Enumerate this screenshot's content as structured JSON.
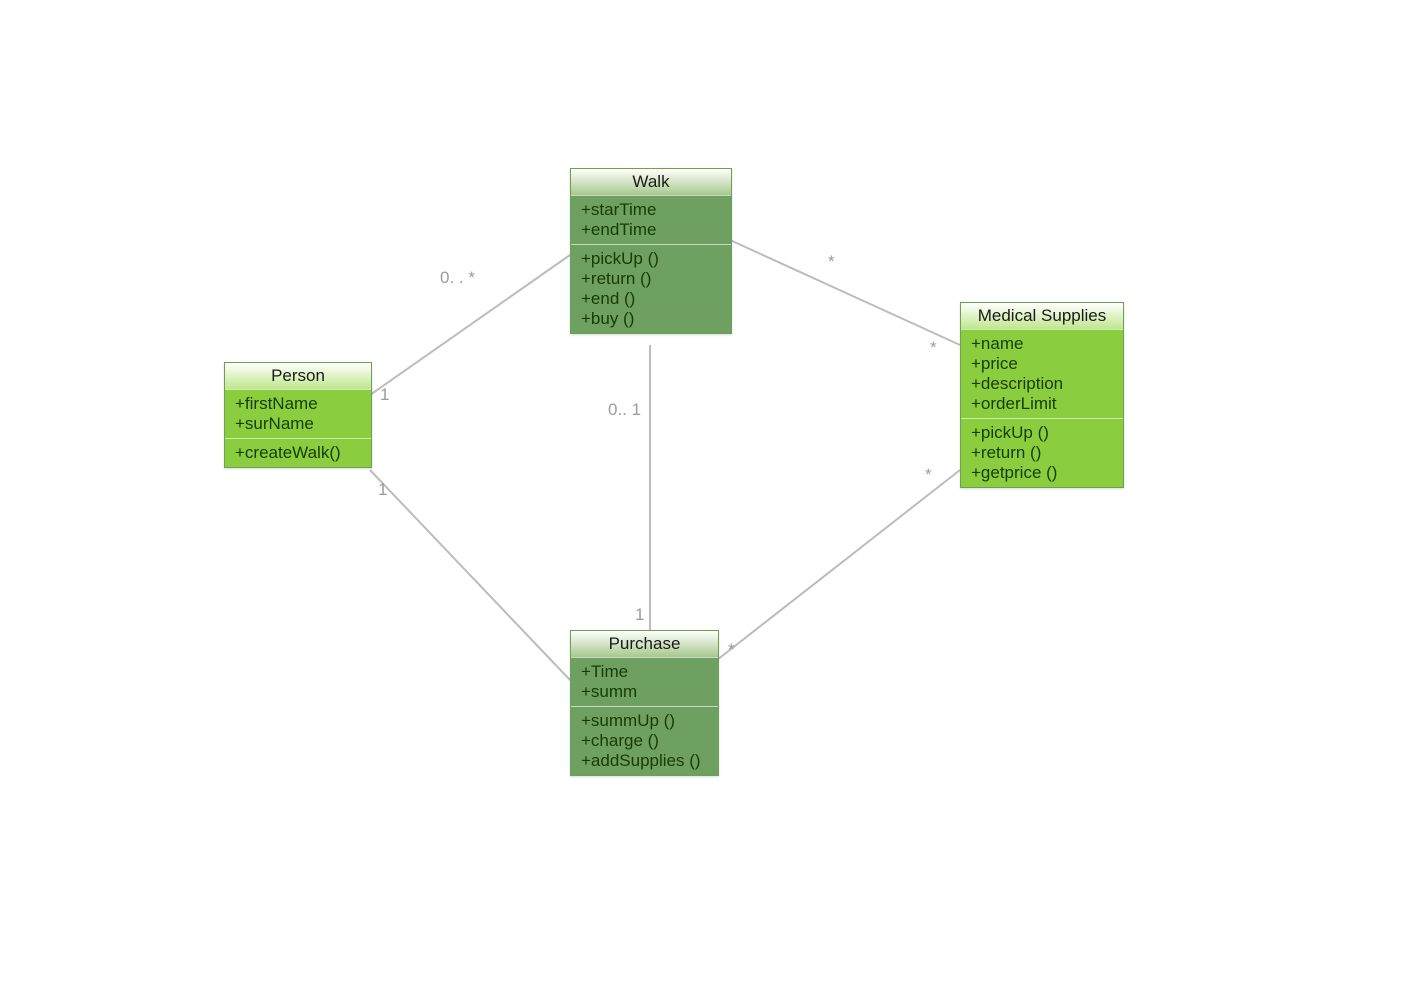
{
  "classes": {
    "person": {
      "name": "Person",
      "attributes": [
        "+firstName",
        "+surName"
      ],
      "methods": [
        "+createWalk()"
      ]
    },
    "walk": {
      "name": "Walk",
      "attributes": [
        "+starTime",
        "+endTime"
      ],
      "methods": [
        "+pickUp ()",
        "+return ()",
        "+end ()",
        "+buy ()"
      ]
    },
    "purchase": {
      "name": "Purchase",
      "attributes": [
        "+Time",
        "+summ"
      ],
      "methods": [
        "+summUp ()",
        "+charge ()",
        "+addSupplies ()"
      ]
    },
    "medical": {
      "name": "Medical Supplies",
      "attributes": [
        "+name",
        "+price",
        "+description",
        "+orderLimit"
      ],
      "methods": [
        "+pickUp ()",
        "+return ()",
        "+getprice ()"
      ]
    }
  },
  "multiplicities": {
    "person_walk_person": "1",
    "person_walk_walk": "0. . *",
    "person_purchase_person": "1",
    "walk_purchase_walk": "0.. 1",
    "walk_purchase_purchase": "1",
    "walk_medical_walk": "*",
    "walk_medical_medical": "*",
    "purchase_medical_purchase": "*",
    "purchase_medical_medical": "*"
  },
  "colors": {
    "light_header_bottom": "#bfe78e",
    "light_body": "#8ace3f",
    "dark_header_bottom": "#a7c88c",
    "dark_body": "#6ea061",
    "line": "#bcbcbc",
    "label": "#9b9b9b"
  }
}
